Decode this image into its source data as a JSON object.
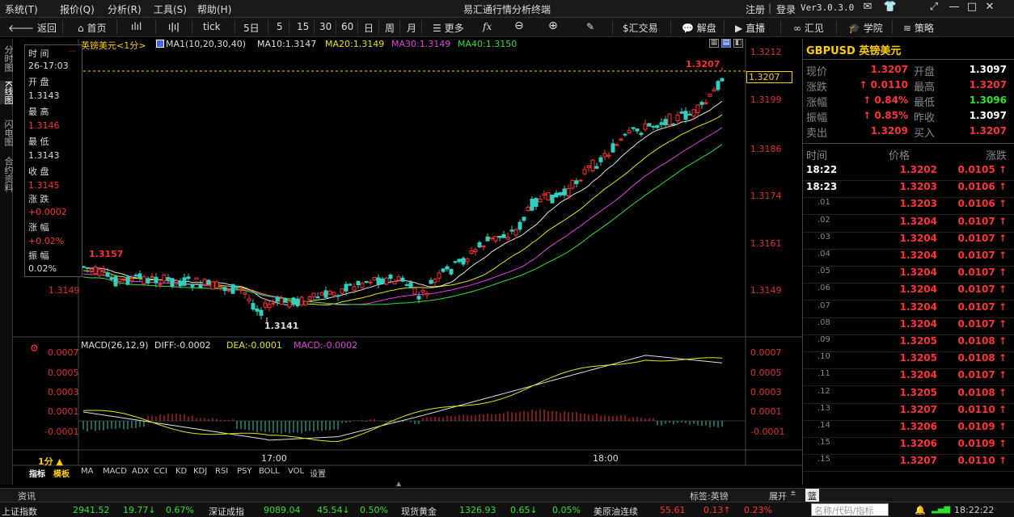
{
  "menu": [
    "系统(T)",
    "报价(Q)",
    "分析(R)",
    "工具(S)",
    "帮助(H)"
  ],
  "app_title": "易汇通行情分析终端",
  "top_right": {
    "register": "注册",
    "sep": "|",
    "login": "登录",
    "version": "Ver3.0.3.0"
  },
  "toolbar": {
    "back": "返回",
    "home": "首页",
    "periods": [
      "tick",
      "5日",
      "5",
      "15",
      "30",
      "60",
      "日",
      "周",
      "月"
    ],
    "more": "更多",
    "fx": "fx",
    "trade": "$汇交易",
    "analysis": "解盘",
    "live": "直播",
    "huijian": "汇见",
    "academy": "学院",
    "strategy": "策略"
  },
  "vertical_tabs": [
    "分时图",
    "K线图",
    "闪电图",
    "合约资料"
  ],
  "chart_title": "英镑美元<1分>",
  "ma_legend": {
    "ma_group": "MA1(10,20,30,40)",
    "items": [
      {
        "label": "MA10:1.3147",
        "color": "#e0e0e0"
      },
      {
        "label": "MA20:1.3149",
        "color": "#e6e600"
      },
      {
        "label": "MA30:1.3149",
        "color": "#e040e0"
      },
      {
        "label": "MA40:1.3150",
        "color": "#30e030"
      }
    ]
  },
  "macd_legend": {
    "title": "MACD(26,12,9)",
    "items": [
      {
        "label": "DIFF:-0.0002",
        "color": "#e0e0e0"
      },
      {
        "label": "DEA:-0.0001",
        "color": "#e6e600"
      },
      {
        "label": "MACD:-0.0002",
        "color": "#e040e0"
      }
    ]
  },
  "infobox": {
    "time_label": "时 间",
    "time_value": "26-17:03",
    "open_label": "开 盘",
    "open_value": "1.3143",
    "high_label": "最 高",
    "high_value": "1.3146",
    "low_label": "最 低",
    "low_value": "1.3143",
    "close_label": "收 盘",
    "close_value": "1.3145",
    "change_label": "涨 跌",
    "change_value": "+0.0002",
    "pct_label": "涨 幅",
    "pct_value": "+0.02%",
    "amp_label": "振 幅",
    "amp_value": "0.02%"
  },
  "chart_data": {
    "type": "candlestick",
    "price_axis_labels": [
      "1.3212",
      "1.3199",
      "1.3186",
      "1.3174",
      "1.3161",
      "1.3149"
    ],
    "left_axis_label": "1.3149",
    "last_price_tag": "1.3207",
    "high_marker": "1.3207",
    "marker_1": "1.3157",
    "low_marker": "1.3141",
    "time_labels": [
      "17:00",
      "18:00"
    ],
    "macd_axis_labels": [
      "0.0007",
      "0.0005",
      "0.0003",
      "0.0001",
      "-0.0001"
    ],
    "colors": {
      "up": "#ff3030",
      "down": "#30d0c0",
      "ma10": "#e0e0e0",
      "ma20": "#e6e600",
      "ma30": "#e040e0",
      "ma40": "#30e030"
    }
  },
  "period_label": "1分 ▲",
  "indicator_tabs": [
    "指标",
    "模板",
    "MA",
    "MACD",
    "ADX",
    "CCI",
    "KD",
    "KDJ",
    "RSI",
    "PSY",
    "BOLL",
    "VOL",
    "设置"
  ],
  "quote": {
    "symbol": "GBPUSD 英镑美元",
    "rows": [
      {
        "l1": "现价",
        "v1": "1.3207",
        "l2": "开盘",
        "v2": "1.3097"
      },
      {
        "l1": "涨跌",
        "v1": "0.0110",
        "l2": "最高",
        "v2": "1.3207"
      },
      {
        "l1": "涨幅",
        "v1": "0.84%",
        "l2": "最低",
        "v2": "1.3096"
      },
      {
        "l1": "振幅",
        "v1": "0.85%",
        "l2": "昨收",
        "v2": "1.3097"
      },
      {
        "l1": "卖出",
        "v1": "1.3209",
        "l2": "买入",
        "v2": "1.3207"
      }
    ],
    "table_headers": [
      "时间",
      "价格",
      "涨跌"
    ],
    "ticks": [
      {
        "t": "18:22",
        "p": "1.3202",
        "c": "0.0105"
      },
      {
        "t": "18:23",
        "p": "1.3203",
        "c": "0.0106"
      },
      {
        "t": ".01",
        "p": "1.3203",
        "c": "0.0106"
      },
      {
        "t": ".02",
        "p": "1.3204",
        "c": "0.0107"
      },
      {
        "t": ".03",
        "p": "1.3204",
        "c": "0.0107"
      },
      {
        "t": ".04",
        "p": "1.3204",
        "c": "0.0107"
      },
      {
        "t": ".05",
        "p": "1.3204",
        "c": "0.0107"
      },
      {
        "t": ".06",
        "p": "1.3204",
        "c": "0.0107"
      },
      {
        "t": ".07",
        "p": "1.3204",
        "c": "0.0107"
      },
      {
        "t": ".08",
        "p": "1.3204",
        "c": "0.0107"
      },
      {
        "t": ".09",
        "p": "1.3205",
        "c": "0.0108"
      },
      {
        "t": ".10",
        "p": "1.3205",
        "c": "0.0108"
      },
      {
        "t": ".11",
        "p": "1.3204",
        "c": "0.0107"
      },
      {
        "t": ".12",
        "p": "1.3205",
        "c": "0.0108"
      },
      {
        "t": ".13",
        "p": "1.3207",
        "c": "0.0110"
      },
      {
        "t": ".14",
        "p": "1.3206",
        "c": "0.0109"
      },
      {
        "t": ".15",
        "p": "1.3206",
        "c": "0.0109"
      },
      {
        "t": ".15",
        "p": "1.3207",
        "c": "0.0110"
      }
    ]
  },
  "news": {
    "label": "资讯",
    "tag": "标签:英镑",
    "expand": "展开",
    "flag": "篮"
  },
  "status": {
    "items": [
      {
        "name": "上证指数",
        "value": "2941.52",
        "chg": "19.77",
        "dir": "down",
        "pct": "0.67%"
      },
      {
        "name": "深证成指",
        "value": "9089.04",
        "chg": "45.54",
        "dir": "down",
        "pct": "0.50%"
      },
      {
        "name": "现货黄金",
        "value": "1326.93",
        "chg": "0.65",
        "dir": "down",
        "pct": "0.05%"
      },
      {
        "name": "美原油连续",
        "value": "55.61",
        "chg": "0.13",
        "dir": "up",
        "pct": "0.23%"
      }
    ],
    "search_placeholder": "名称/代码/指标",
    "clock": "18:22:22"
  }
}
